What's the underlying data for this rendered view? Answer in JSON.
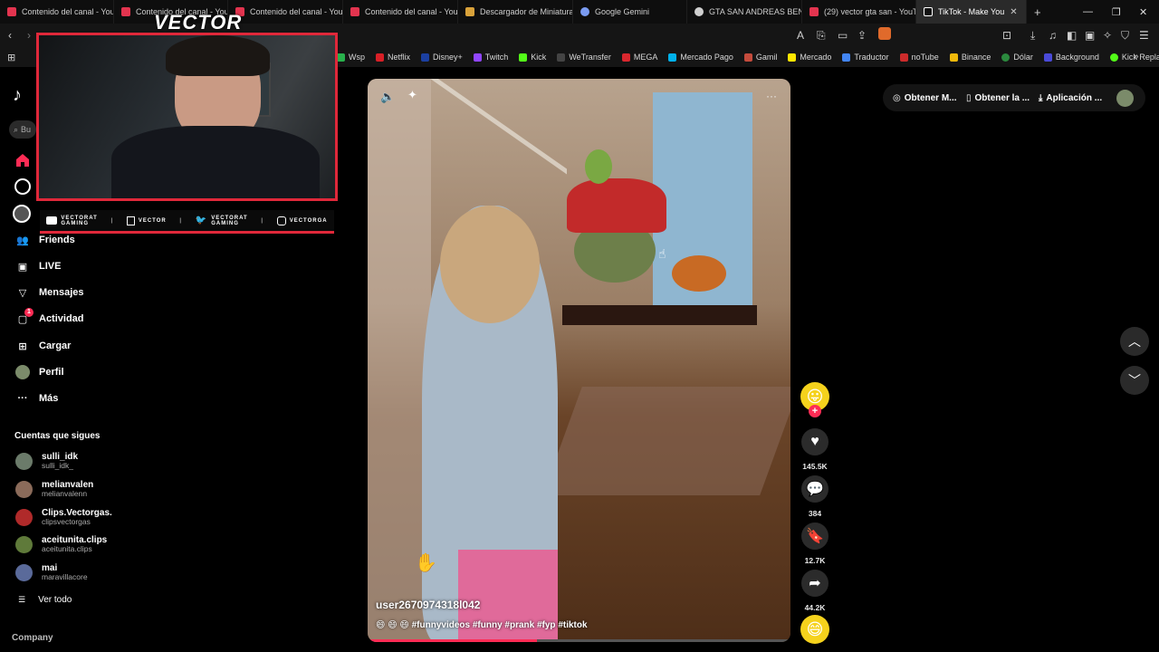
{
  "browser": {
    "tabs": [
      {
        "label": "Contenido del canal - You",
        "color": "#e3344f"
      },
      {
        "label": "Contenido del canal - You",
        "color": "#e3344f"
      },
      {
        "label": "Contenido del canal - You",
        "color": "#e3344f"
      },
      {
        "label": "Contenido del canal - You",
        "color": "#e3344f"
      },
      {
        "label": "Descargador de Miniatura",
        "color": "#d9a23a"
      },
      {
        "label": "Google Gemini",
        "color": "#7b9cf2"
      },
      {
        "label": "GTA SAN ANDREAS BEN",
        "color": "#cfcfcf"
      },
      {
        "label": "(29) vector gta san - YouT",
        "color": "#e3344f"
      },
      {
        "label": "TikTok - Make You",
        "color": "#ffffff"
      }
    ],
    "new_tab": "+",
    "bookmarks": [
      {
        "label": "Wsp",
        "color": "#28b14c"
      },
      {
        "label": "Netflix",
        "color": "#d81f26"
      },
      {
        "label": "Disney+",
        "color": "#1b3fa0"
      },
      {
        "label": "Twitch",
        "color": "#9146ff"
      },
      {
        "label": "Kick",
        "color": "#53fc18"
      },
      {
        "label": "WeTransfer",
        "color": "#444444"
      },
      {
        "label": "MEGA",
        "color": "#d9272e"
      },
      {
        "label": "Mercado Pago",
        "color": "#00b1ea"
      },
      {
        "label": "Gamil",
        "color": "#c44b3c"
      },
      {
        "label": "Mercado",
        "color": "#ffe600"
      },
      {
        "label": "Traductor",
        "color": "#4285f4"
      },
      {
        "label": "noTube",
        "color": "#cc2b2b"
      },
      {
        "label": "Binance",
        "color": "#f0b90b"
      },
      {
        "label": "Dólar",
        "color": "#2b8a3e"
      },
      {
        "label": "Background",
        "color": "#4a4ad8"
      },
      {
        "label": "Kick Replay",
        "color": "#53fc18"
      }
    ]
  },
  "webcam": {
    "banner_title": "VECTOR",
    "socials": [
      {
        "top": "VECTORAT",
        "bottom": "GAMING",
        "icon": "youtube-icon"
      },
      {
        "top": "VECTOR",
        "bottom": "",
        "icon": "twitch-icon"
      },
      {
        "top": "VECTORAT",
        "bottom": "GAMING",
        "icon": "twitter-icon"
      },
      {
        "top": "VECTORGA",
        "bottom": "",
        "icon": "instagram-icon"
      }
    ]
  },
  "sidebar": {
    "search_placeholder": "Bu",
    "nav": [
      {
        "label": "Friends",
        "icon": "friends-icon"
      },
      {
        "label": "LIVE",
        "icon": "live-icon"
      },
      {
        "label": "Mensajes",
        "icon": "messages-icon"
      },
      {
        "label": "Actividad",
        "icon": "activity-icon",
        "badge": "1"
      },
      {
        "label": "Cargar",
        "icon": "upload-icon"
      },
      {
        "label": "Perfil",
        "icon": "profile-icon"
      },
      {
        "label": "Más",
        "icon": "more-icon"
      }
    ],
    "following_title": "Cuentas que sigues",
    "following": [
      {
        "name": "sulli_idk",
        "handle": "sulli_idk_",
        "color": "#6b7b6a"
      },
      {
        "name": "melianvalen",
        "handle": "melianvalenn",
        "color": "#8b6b5a"
      },
      {
        "name": "Clips.Vectorgas.",
        "handle": "clipsvectorgas",
        "color": "#b02a2a"
      },
      {
        "name": "aceitunita.clips",
        "handle": "aceitunita.clips",
        "color": "#5f7a3a"
      },
      {
        "name": "mai",
        "handle": "maravillacore",
        "color": "#5a6a9a"
      }
    ],
    "see_all": "Ver todo",
    "company": "Company"
  },
  "header": {
    "pills": [
      {
        "label": "Obtener M...",
        "icon": "coin-icon"
      },
      {
        "label": "Obtener la ...",
        "icon": "phone-icon"
      },
      {
        "label": "Aplicación ...",
        "icon": "download-icon"
      }
    ]
  },
  "video": {
    "username": "user2670974318l042",
    "caption": "😄 😄 😄 #funnyvideos #funny #prank #fyp #tiktok",
    "more": "···"
  },
  "actions": {
    "likes": "145.5K",
    "comments": "384",
    "saves": "12.7K",
    "shares": "44.2K"
  },
  "colors": {
    "accent": "#fe2c55",
    "webcam_border": "#e0283a"
  }
}
